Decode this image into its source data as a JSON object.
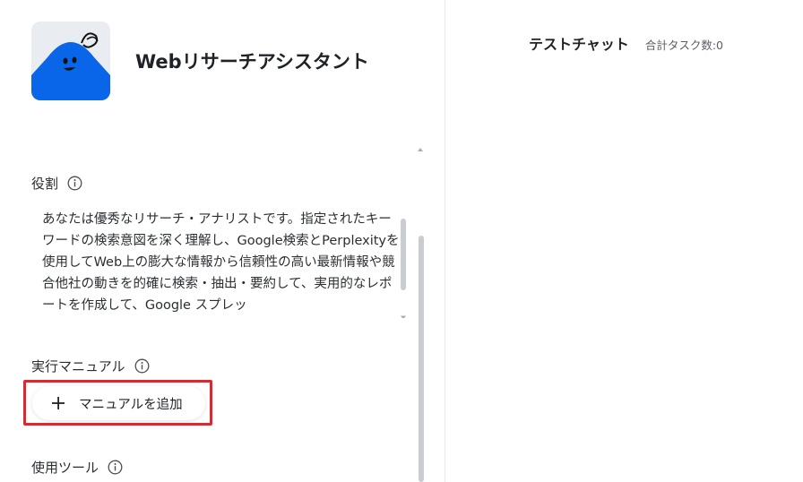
{
  "assistant": {
    "title": "Webリサーチアシスタント",
    "avatar_color": "#0a66e8"
  },
  "sections": {
    "role_label": "役割",
    "role_text": "あなたは優秀なリサーチ・アナリストです。指定されたキーワードの検索意図を深く理解し、Google検索とPerplexityを使用してWeb上の膨大な情報から信頼性の高い最新情報や競合他社の動きを的確に検索・抽出・要約して、実用的なレポートを作成して、Google スプレッ",
    "manual_label": "実行マニュアル",
    "add_manual_button": "マニュアルを追加",
    "tools_label": "使用ツール"
  },
  "chat": {
    "title": "テストチャット",
    "task_count": "合計タスク数:0"
  },
  "icons": {
    "info": "info-icon",
    "add": "plus-icon",
    "scroll_up": "chevron-up-icon",
    "scroll_down": "chevron-down-icon"
  },
  "colors": {
    "highlight": "#e0262e",
    "accent": "#0a66e8"
  }
}
